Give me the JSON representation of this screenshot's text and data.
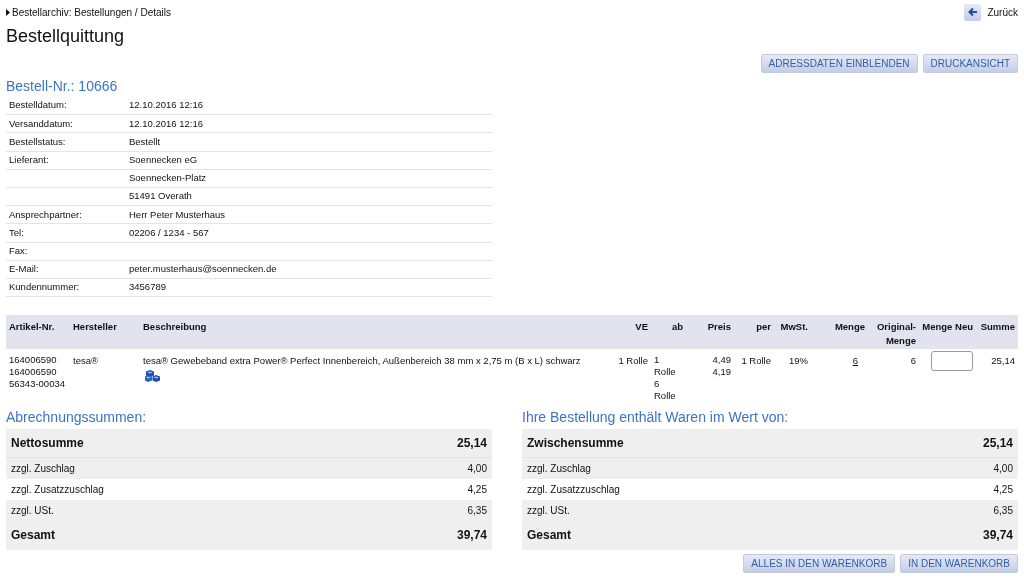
{
  "breadcrumb": "Bestellarchiv: Bestellungen / Details",
  "back_link": "Zurück",
  "title": "Bestellquittung",
  "top_buttons": [
    "ADRESSDATEN EINBLENDEN",
    "DRUCKANSICHT"
  ],
  "order_number": "Bestell-Nr.: 10666",
  "details": [
    {
      "label": "Bestelldatum:",
      "value": "12.10.2016 12:16"
    },
    {
      "label": "Versanddatum:",
      "value": "12.10.2016 12:16"
    },
    {
      "label": "Bestellstatus:",
      "value": "Bestellt"
    },
    {
      "label": "Lieferant:",
      "value": "Soennecken eG"
    },
    {
      "value": "Soennecken-Platz"
    },
    {
      "value": "51491 Overath"
    },
    {
      "label": "Ansprechpartner:",
      "value": "Herr Peter Musterhaus"
    },
    {
      "label": "Tel:",
      "value": "02206 / 1234 - 567"
    },
    {
      "label": "Fax:"
    },
    {
      "label": "E-Mail:",
      "value": "peter.musterhaus@soennecken.de"
    },
    {
      "label": "Kundennummer:",
      "value": "3456789"
    }
  ],
  "items_table": {
    "columns": [
      "Artikel-Nr.",
      "Hersteller",
      "Beschreibung",
      "VE",
      "ab",
      "Preis",
      "per",
      "MwSt.",
      "Menge",
      "Original-Menge",
      "Menge Neu",
      "Summe"
    ],
    "rows": [
      {
        "article_numbers": [
          "164006590",
          "164006590",
          "56343-00034"
        ],
        "manufacturer": "tesa®",
        "description": "tesa® Gewebeband extra Power® Perfect Innenbereich, Außenbereich 38 mm x 2,75 m (B x L) schwarz",
        "ve": "1 Rolle",
        "ab": [
          "1 Rolle",
          "6 Rolle"
        ],
        "prices": [
          "4,49",
          "4,19"
        ],
        "per": "1 Rolle",
        "vat": "19%",
        "quantity": "6",
        "original_quantity": "6",
        "sum": "25,14"
      }
    ]
  },
  "summaries": [
    {
      "heading": "Abrechnungssummen:",
      "rows": [
        {
          "kind": "total",
          "label": "Nettosumme",
          "value": "25,14"
        },
        {
          "kind": "line",
          "label": "zzgl. Zuschlag",
          "value": "4,00"
        },
        {
          "kind": "line",
          "label": "zzgl. Zusatzzuschlag",
          "value": "4,25"
        },
        {
          "kind": "line",
          "label": "zzgl. USt.",
          "value": "6,35"
        },
        {
          "kind": "total",
          "label": "Gesamt",
          "value": "39,74"
        }
      ]
    },
    {
      "heading": "Ihre Bestellung enthält Waren im Wert von:",
      "rows": [
        {
          "kind": "total",
          "label": "Zwischensumme",
          "value": "25,14"
        },
        {
          "kind": "line",
          "label": "zzgl. Zuschlag",
          "value": "4,00"
        },
        {
          "kind": "line",
          "label": "zzgl. Zusatzzuschlag",
          "value": "4,25"
        },
        {
          "kind": "line",
          "label": "zzgl. USt.",
          "value": "6,35"
        },
        {
          "kind": "total",
          "label": "Gesamt",
          "value": "39,74"
        }
      ]
    }
  ],
  "bottom_buttons": [
    "ALLES IN DEN WARENKORB",
    "IN DEN WARENKORB"
  ]
}
